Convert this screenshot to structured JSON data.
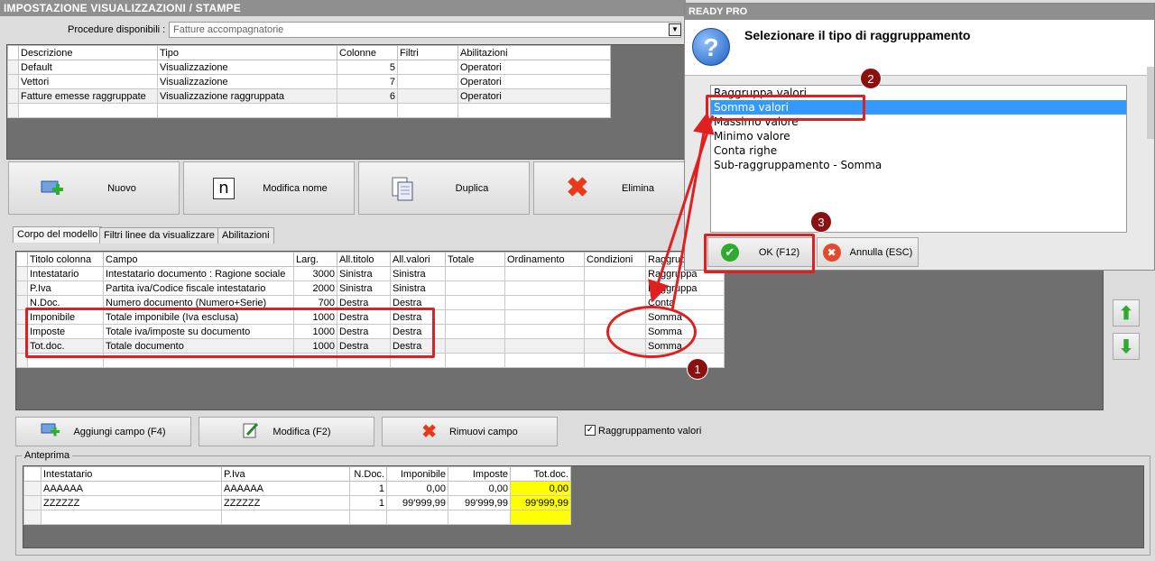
{
  "window_title": "IMPOSTAZIONE VISUALIZZAZIONI / STAMPE",
  "procedure": {
    "label": "Procedure disponibili :",
    "value": "Fatture accompagnatorie"
  },
  "views_table": {
    "headers": [
      "Descrizione",
      "Tipo",
      "Colonne",
      "Filtri",
      "Abilitazioni"
    ],
    "rows": [
      {
        "descr": "Default",
        "tipo": "Visualizzazione",
        "colonne": "5",
        "filtri": "",
        "abil": "Operatori"
      },
      {
        "descr": "Vettori",
        "tipo": "Visualizzazione",
        "colonne": "7",
        "filtri": "",
        "abil": "Operatori"
      },
      {
        "descr": "Fatture emesse raggruppate",
        "tipo": "Visualizzazione raggruppata",
        "colonne": "6",
        "filtri": "",
        "abil": "Operatori"
      }
    ]
  },
  "toolbar": {
    "new": "Nuovo",
    "rename": "Modifica nome",
    "duplicate": "Duplica",
    "delete": "Elimina"
  },
  "tabs": [
    "Corpo del modello",
    "Filtri linee da visualizzare",
    "Abilitazioni"
  ],
  "fields_table": {
    "headers": [
      "Titolo colonna",
      "Campo",
      "Larg.",
      "All.titolo",
      "All.valori",
      "Totale",
      "Ordinamento",
      "Condizioni",
      "Raggruppa"
    ],
    "rows": [
      {
        "titolo": "Intestatario",
        "campo": "Intestatario documento : Ragione sociale",
        "larg": "3000",
        "alltit": "Sinistra",
        "allval": "Sinistra",
        "tot": "",
        "ord": "",
        "cond": "",
        "ragg": "Raggruppa"
      },
      {
        "titolo": "P.Iva",
        "campo": "Partita iva/Codice fiscale intestatario",
        "larg": "2000",
        "alltit": "Sinistra",
        "allval": "Sinistra",
        "tot": "",
        "ord": "",
        "cond": "",
        "ragg": "Raggruppa"
      },
      {
        "titolo": "N.Doc.",
        "campo": "Numero documento (Numero+Serie)",
        "larg": "700",
        "alltit": "Destra",
        "allval": "Destra",
        "tot": "",
        "ord": "",
        "cond": "",
        "ragg": "Conta"
      },
      {
        "titolo": "Imponibile",
        "campo": "Totale imponibile (Iva esclusa)",
        "larg": "1000",
        "alltit": "Destra",
        "allval": "Destra",
        "tot": "",
        "ord": "",
        "cond": "",
        "ragg": "Somma"
      },
      {
        "titolo": "Imposte",
        "campo": "Totale iva/imposte su documento",
        "larg": "1000",
        "alltit": "Destra",
        "allval": "Destra",
        "tot": "",
        "ord": "",
        "cond": "",
        "ragg": "Somma"
      },
      {
        "titolo": "Tot.doc.",
        "campo": "Totale documento",
        "larg": "1000",
        "alltit": "Destra",
        "allval": "Destra",
        "tot": "",
        "ord": "",
        "cond": "",
        "ragg": "Somma"
      }
    ]
  },
  "field_actions": {
    "add": "Aggiungi campo (F4)",
    "edit": "Modifica (F2)",
    "remove": "Rimuovi campo",
    "group_check": "Raggruppamento valori"
  },
  "preview": {
    "label": "Anteprima",
    "headers": [
      "Intestatario",
      "P.Iva",
      "N.Doc.",
      "Imponibile",
      "Imposte",
      "Tot.doc."
    ],
    "rows": [
      [
        "AAAAAA",
        "AAAAAA",
        "1",
        "0,00",
        "0,00",
        "0,00"
      ],
      [
        "ZZZZZZ",
        "ZZZZZZ",
        "1",
        "99'999,99",
        "99'999,99",
        "99'999,99"
      ]
    ]
  },
  "dialog": {
    "title": "READY PRO",
    "question": "Selezionare il tipo di raggruppamento",
    "options": [
      "Raggruppa valori",
      "Somma valori",
      "Massimo valore",
      "Minimo valore",
      "Conta righe",
      "Sub-raggruppamento - Somma"
    ],
    "selected": "Somma valori",
    "ok": "OK (F12)",
    "cancel": "Annulla (ESC)"
  },
  "badges": [
    "1",
    "2",
    "3"
  ],
  "colors": {
    "annotation": "#e02020",
    "badge": "#8b1010",
    "selection": "#3399ff",
    "highlight": "#ffff00"
  }
}
